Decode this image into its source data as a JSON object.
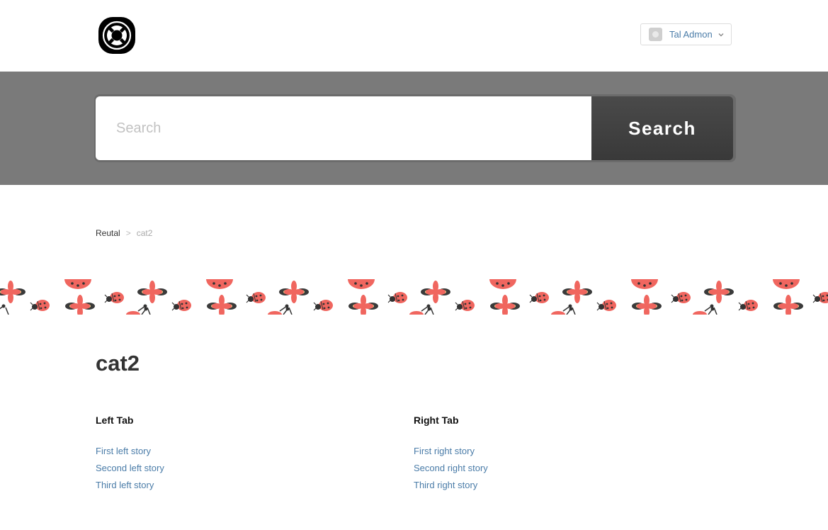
{
  "header": {
    "logo_icon": "lifebuoy-icon",
    "user": {
      "name": "Tal Admon",
      "avatar_icon": "avatar-icon",
      "dropdown_icon": "chevron-down-icon"
    }
  },
  "search": {
    "placeholder": "Search",
    "value": "",
    "button_label": "Search"
  },
  "breadcrumb": {
    "items": [
      "Reutal",
      "cat2"
    ],
    "separator": ">"
  },
  "banner": {
    "pattern_icons": [
      "ladybug-icon",
      "flower-icon"
    ]
  },
  "page": {
    "title": "cat2"
  },
  "tabs": {
    "left": {
      "heading": "Left Tab",
      "stories": [
        "First left story",
        "Second left story",
        "Third left story"
      ]
    },
    "right": {
      "heading": "Right Tab",
      "stories": [
        "First right story",
        "Second right story",
        "Third right story"
      ]
    }
  },
  "colors": {
    "hero_background": "#7a7a7a",
    "search_button": "#3e3e3e",
    "link": "#4a7ca8",
    "ladybug": "#f0665f",
    "flower_petal": "#f0665f",
    "flower_leaf": "#3a3a3a",
    "flower_center": "#f6d889"
  }
}
